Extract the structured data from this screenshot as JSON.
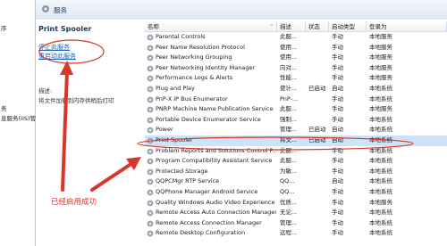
{
  "left_strip": {
    "items": [
      "序",
      "",
      "",
      "",
      "",
      "",
      "",
      "",
      "",
      "务",
      "息服务(IIS)管"
    ]
  },
  "header": {
    "title": "服务"
  },
  "detail": {
    "service_name": "Print Spooler",
    "actions": [
      "停止此服务",
      "重启动此服务"
    ],
    "description_label": "描述:",
    "description": "将文件加载到内存供稍后打印"
  },
  "table": {
    "columns": [
      "名称",
      "描述",
      "状态",
      "启动类型",
      "登录为"
    ],
    "rows": [
      {
        "name": "Parental Controls",
        "desc": "此服...",
        "status": "",
        "startup": "手动",
        "logon": "本地服务"
      },
      {
        "name": "Peer Name Resolution Protocol",
        "desc": "使用...",
        "status": "",
        "startup": "手动",
        "logon": "本地服务"
      },
      {
        "name": "Peer Networking Grouping",
        "desc": "使用...",
        "status": "",
        "startup": "手动",
        "logon": "本地服务"
      },
      {
        "name": "Peer Networking Identity Manager",
        "desc": "向对...",
        "status": "",
        "startup": "手动",
        "logon": "本地服务"
      },
      {
        "name": "Performance Logs & Alerts",
        "desc": "性能...",
        "status": "",
        "startup": "手动",
        "logon": "本地服务"
      },
      {
        "name": "Plug and Play",
        "desc": "使计...",
        "status": "已启动",
        "startup": "自动",
        "logon": "本地系统"
      },
      {
        "name": "PnP-X IP Bus Enumerator",
        "desc": "PnP-...",
        "status": "",
        "startup": "手动",
        "logon": "本地系统"
      },
      {
        "name": "PNRP Machine Name Publication Service",
        "desc": "此服...",
        "status": "",
        "startup": "手动",
        "logon": "本地服务"
      },
      {
        "name": "Portable Device Enumerator Service",
        "desc": "强制...",
        "status": "",
        "startup": "手动",
        "logon": "本地系统"
      },
      {
        "name": "Power",
        "desc": "管理...",
        "status": "已启动",
        "startup": "自动",
        "logon": "本地系统"
      },
      {
        "name": "Print Spooler",
        "desc": "将文...",
        "status": "已启动",
        "startup": "自动",
        "logon": "本地系统"
      },
      {
        "name": "Problem Reports and Solutions Control P...",
        "desc": "此服...",
        "status": "",
        "startup": "手动",
        "logon": "本地系统"
      },
      {
        "name": "Program Compatibility Assistant Service",
        "desc": "此服...",
        "status": "",
        "startup": "手动",
        "logon": "本地系统"
      },
      {
        "name": "Protected Storage",
        "desc": "为敏...",
        "status": "",
        "startup": "手动",
        "logon": "本地系统"
      },
      {
        "name": "QQPCMgr RTP Service",
        "desc": "QQ...",
        "status": "",
        "startup": "自动",
        "logon": "本地系统"
      },
      {
        "name": "QQPhone Manager Android Service",
        "desc": "QQ...",
        "status": "",
        "startup": "手动",
        "logon": "本地系统"
      },
      {
        "name": "Quality Windows Audio Video Experience",
        "desc": "优质...",
        "status": "",
        "startup": "手动",
        "logon": "本地服务"
      },
      {
        "name": "Remote Access Auto Connection Manager",
        "desc": "无论...",
        "status": "",
        "startup": "手动",
        "logon": "本地系统"
      },
      {
        "name": "Remote Access Connection Manager",
        "desc": "管理...",
        "status": "",
        "startup": "手动",
        "logon": "本地系统"
      },
      {
        "name": "Remote Desktop Configuration",
        "desc": "远程...",
        "status": "",
        "startup": "手动",
        "logon": "本地系统"
      }
    ]
  },
  "annotation": {
    "text": "已经启用成功"
  },
  "colors": {
    "annotation": "#d9362b",
    "link": "#1565c0",
    "selection": "#cde3f7"
  }
}
